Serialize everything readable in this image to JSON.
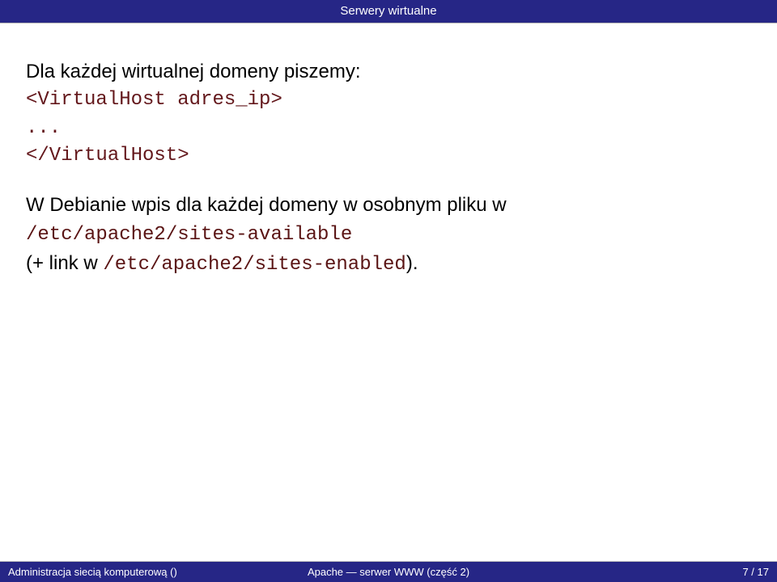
{
  "header": {
    "title": "Serwery wirtualne"
  },
  "body": {
    "intro": "Dla każdej wirtualnej domeny piszemy:",
    "code_open": "<VirtualHost adres_ip>",
    "code_dots": "...",
    "code_close": "</VirtualHost>",
    "debian_line": "W Debianie wpis dla każdej domeny w osobnym pliku w",
    "path_available": "/etc/apache2/sites-available",
    "link_prefix": "(+ link w ",
    "path_enabled": "/etc/apache2/sites-enabled",
    "link_suffix": ")."
  },
  "footer": {
    "left": "Administracja siecią komputerową ()",
    "center": "Apache — serwer WWW (część 2)",
    "right": "7 / 17"
  }
}
